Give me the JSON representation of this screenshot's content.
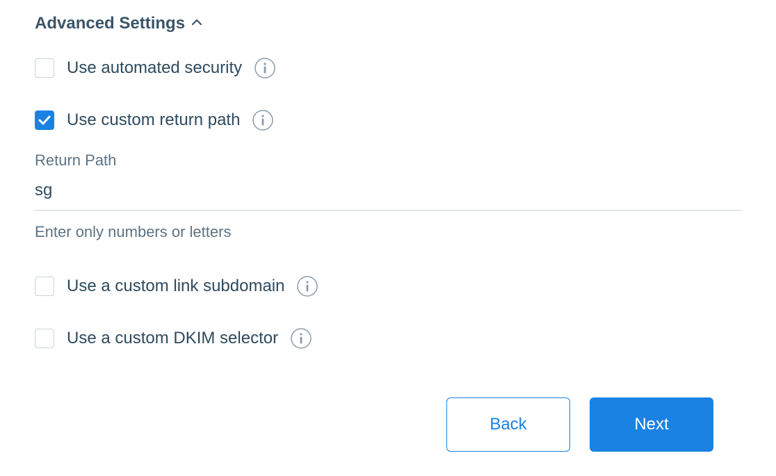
{
  "section": {
    "title": "Advanced Settings"
  },
  "options": {
    "automated_security": {
      "label": "Use automated security",
      "checked": false
    },
    "custom_return_path": {
      "label": "Use custom return path",
      "checked": true
    },
    "custom_link_subdomain": {
      "label": "Use a custom link subdomain",
      "checked": false
    },
    "custom_dkim_selector": {
      "label": "Use a custom DKIM selector",
      "checked": false
    }
  },
  "return_path": {
    "label": "Return Path",
    "value": "sg",
    "hint": "Enter only numbers or letters"
  },
  "buttons": {
    "back": "Back",
    "next": "Next"
  }
}
